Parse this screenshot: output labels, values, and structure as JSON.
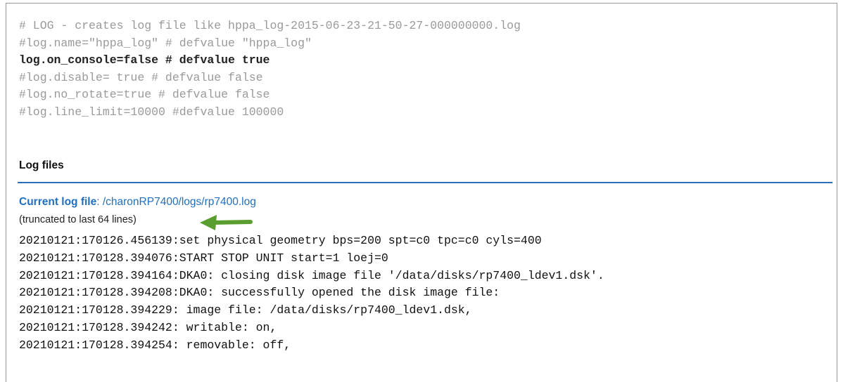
{
  "config": {
    "lines": [
      {
        "text": "# LOG - creates log file like hppa_log-2015-06-23-21-50-27-000000000.log"
      },
      {
        "text": "#log.name=\"hppa_log\" # defvalue \"hppa_log\""
      },
      {
        "text": "log.on_console=false # defvalue true"
      },
      {
        "text": "#log.disable= true # defvalue false"
      },
      {
        "text": "#log.no_rotate=true # defvalue false"
      },
      {
        "text": "#log.line_limit=10000 #defvalue 100000"
      }
    ]
  },
  "log_section": {
    "heading": "Log files",
    "current_label": "Current log file",
    "current_path": ": /charonRP7400/logs/rp7400.log",
    "truncated_note": "(truncated to last 64 lines)",
    "lines": [
      "20210121:170126.456139:set physical geometry bps=200 spt=c0 tpc=c0 cyls=400",
      "20210121:170128.394076:START STOP UNIT start=1 loej=0",
      "20210121:170128.394164:DKA0: closing disk image file '/data/disks/rp7400_ldev1.dsk'.",
      "20210121:170128.394208:DKA0: successfully opened the disk image file:",
      "20210121:170128.394229: image file: /data/disks/rp7400_ldev1.dsk,",
      "20210121:170128.394242: writable: on,",
      "20210121:170128.394254: removable: off,"
    ]
  },
  "colors": {
    "accent_blue": "#1f6fc2",
    "rule_blue": "#2a6ebb",
    "arrow_green": "#5a9e2f",
    "comment_gray": "#9a9a9a"
  },
  "icons": {
    "annotation_arrow": "green-left-arrow-icon"
  }
}
